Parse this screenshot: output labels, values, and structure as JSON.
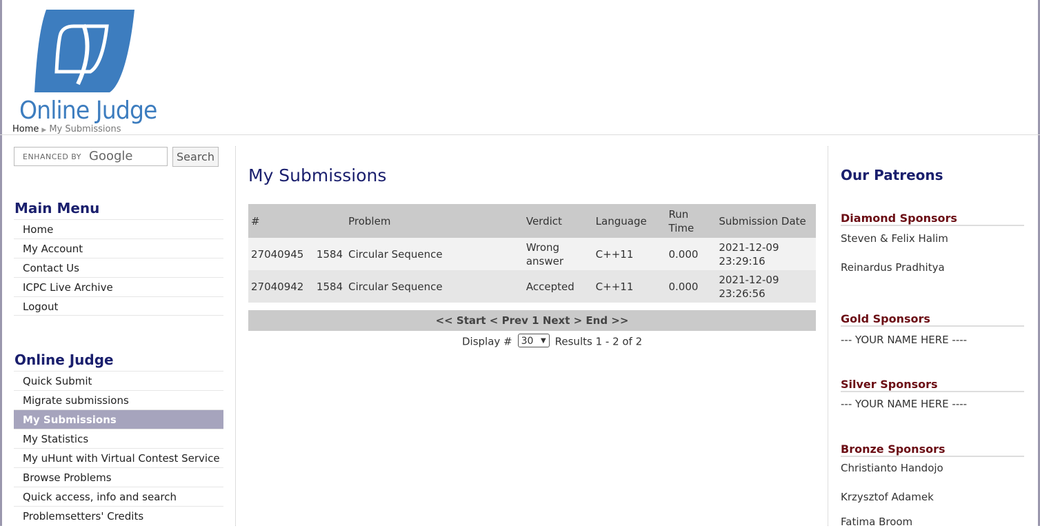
{
  "header": {
    "logo_text": "Online Judge",
    "breadcrumb": {
      "home": "Home",
      "current": "My Submissions"
    }
  },
  "search": {
    "google_prefix": "ENHANCED BY",
    "google_brand": "Google",
    "button_label": "Search"
  },
  "main_menu": {
    "title": "Main Menu",
    "items": [
      "Home",
      "My Account",
      "Contact Us",
      "ICPC Live Archive",
      "Logout"
    ]
  },
  "online_judge_menu": {
    "title": "Online Judge",
    "items": [
      "Quick Submit",
      "Migrate submissions",
      "My Submissions",
      "My Statistics",
      "My uHunt with Virtual Contest Service",
      "Browse Problems",
      "Quick access, info and search",
      "Problemsetters' Credits"
    ],
    "active": "My Submissions"
  },
  "main": {
    "title": "My Submissions",
    "columns": [
      "#",
      "Problem",
      "Verdict",
      "Language",
      "Run Time",
      "Submission Date"
    ],
    "rows": [
      {
        "id": "27040945",
        "problem_id": "1584",
        "problem_name": "Circular Sequence",
        "verdict": "Wrong answer",
        "language": "C++11",
        "run_time": "0.000",
        "date": "2021-12-09 23:29:16"
      },
      {
        "id": "27040942",
        "problem_id": "1584",
        "problem_name": "Circular Sequence",
        "verdict": "Accepted",
        "language": "C++11",
        "run_time": "0.000",
        "date": "2021-12-09 23:26:56"
      }
    ],
    "pager": "<< Start < Prev 1 Next > End >>",
    "display_label": "Display #",
    "display_value": "30",
    "results": "Results 1 - 2 of 2"
  },
  "patreons": {
    "title": "Our Patreons",
    "diamond": {
      "heading": "Diamond Sponsors",
      "names": [
        "Steven & Felix Halim",
        "Reinardus Pradhitya"
      ]
    },
    "gold": {
      "heading": "Gold Sponsors",
      "names": [
        "--- YOUR NAME HERE ----"
      ]
    },
    "silver": {
      "heading": "Silver Sponsors",
      "names": [
        "--- YOUR NAME HERE ----"
      ]
    },
    "bronze": {
      "heading": "Bronze Sponsors",
      "names": [
        "Christianto Handojo",
        "Krzysztof Adamek",
        "Fatima Broom"
      ]
    }
  },
  "colors": {
    "logo_blue": "#3d7dbf",
    "heading_navy": "#1a1f6d",
    "sponsor_red": "#6b0d14",
    "active_menu": "#a6a4bd",
    "link_red": "#8c1010"
  }
}
